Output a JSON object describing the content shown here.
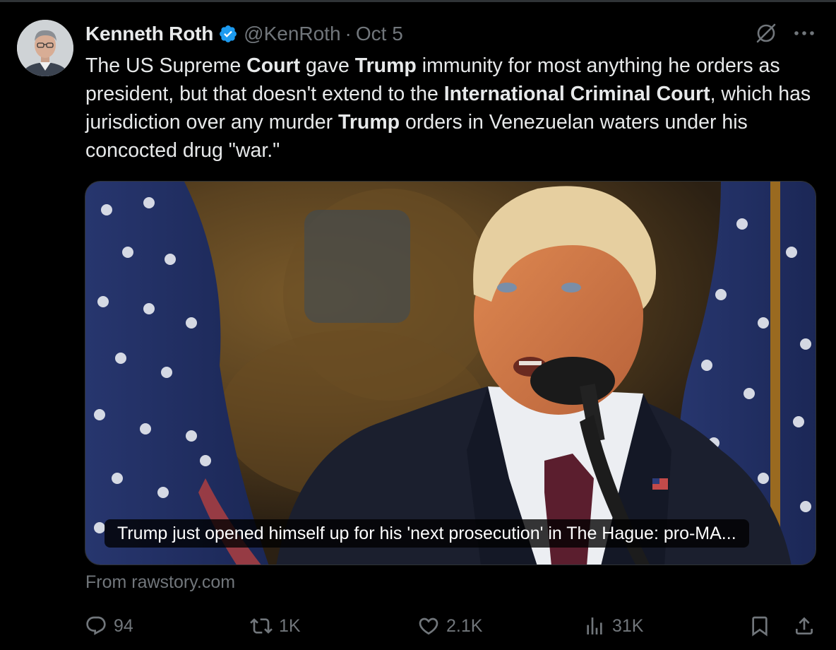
{
  "tweet": {
    "author": {
      "display_name": "Kenneth Roth",
      "handle": "@KenRoth",
      "verified": true
    },
    "separator": "·",
    "date": "Oct 5",
    "text_segments": [
      {
        "text": "The US Supreme ",
        "bold": false
      },
      {
        "text": "Court",
        "bold": true
      },
      {
        "text": " gave ",
        "bold": false
      },
      {
        "text": "Trump",
        "bold": true
      },
      {
        "text": " immunity for most anything he orders as president, but that doesn't extend to the ",
        "bold": false
      },
      {
        "text": "International Criminal Court",
        "bold": true
      },
      {
        "text": ", which has jurisdiction over any murder ",
        "bold": false
      },
      {
        "text": "Trump",
        "bold": true
      },
      {
        "text": " orders in Venezuelan waters under his concocted drug \"war.\"",
        "bold": false
      }
    ],
    "link_card": {
      "caption": "Trump just opened himself up for his 'next prosecution' in The Hague: pro-MA...",
      "source": "From rawstory.com"
    },
    "actions": {
      "replies": "94",
      "reposts": "1K",
      "likes": "2.1K",
      "views": "31K"
    }
  },
  "icons": {
    "verified": "verified-badge-icon",
    "grok": "grok-icon",
    "more": "more-icon",
    "reply": "reply-icon",
    "repost": "repost-icon",
    "like": "like-icon",
    "views": "views-icon",
    "bookmark": "bookmark-icon",
    "share": "share-icon"
  },
  "colors": {
    "background": "#000000",
    "text": "#e7e9ea",
    "secondary": "#71767b",
    "verified_blue": "#1d9bf0"
  }
}
